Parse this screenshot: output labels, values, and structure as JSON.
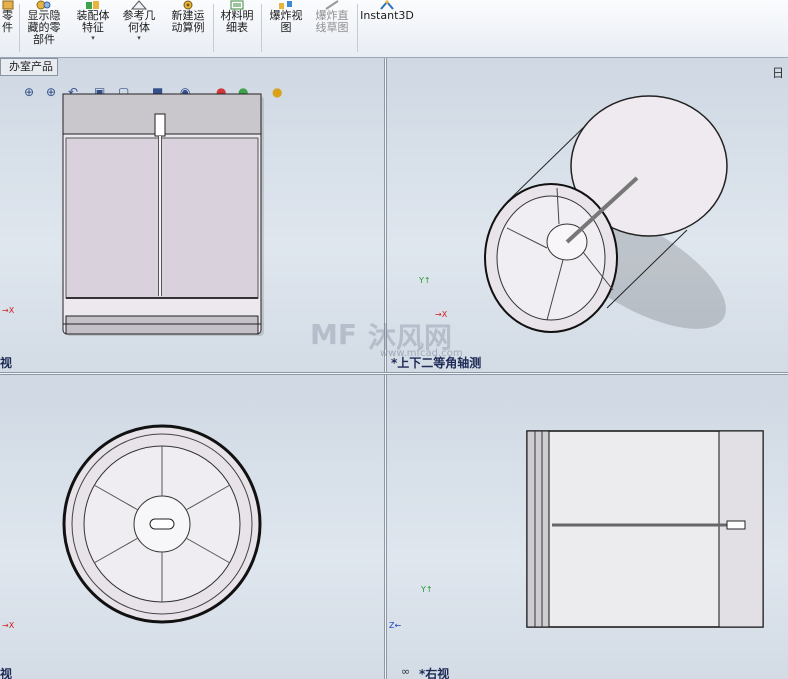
{
  "toolbar": {
    "items": [
      {
        "label": "零\n件",
        "icon": "part-icon"
      },
      {
        "label": "显示隐\n藏的零\n部件",
        "icon": "show-hidden-components-icon"
      },
      {
        "label": "装配体\n特征",
        "icon": "assembly-features-icon",
        "dropdown": "▾"
      },
      {
        "label": "参考几\n何体",
        "icon": "reference-geometry-icon",
        "dropdown": "▾"
      },
      {
        "label": "新建运\n动算例",
        "icon": "new-motion-study-icon"
      },
      {
        "label": "材料明\n细表",
        "icon": "bill-of-materials-icon"
      },
      {
        "label": "爆炸视\n图",
        "icon": "exploded-view-icon"
      },
      {
        "label": "爆炸直\n线草图",
        "icon": "explode-line-sketch-icon"
      },
      {
        "label": "Instant3D",
        "icon": "instant3d-icon"
      }
    ]
  },
  "tree_tab": {
    "label": "办室产品"
  },
  "viewports": {
    "top_left": {
      "label": "视"
    },
    "top_right": {
      "label": "*上下二等角轴测",
      "corner": "日"
    },
    "bottom_left": {
      "label": "视"
    },
    "bottom_right": {
      "label": "*右视"
    }
  },
  "triad": {
    "x": "X",
    "y": "Y",
    "z": "Z"
  },
  "watermark": {
    "brand": "沐风网",
    "url": "www.mfcad.com"
  },
  "colors": {
    "accent": "#33508a",
    "x_axis": "#d02020",
    "y_axis": "#1f9a30",
    "z_axis": "#2040c0"
  }
}
